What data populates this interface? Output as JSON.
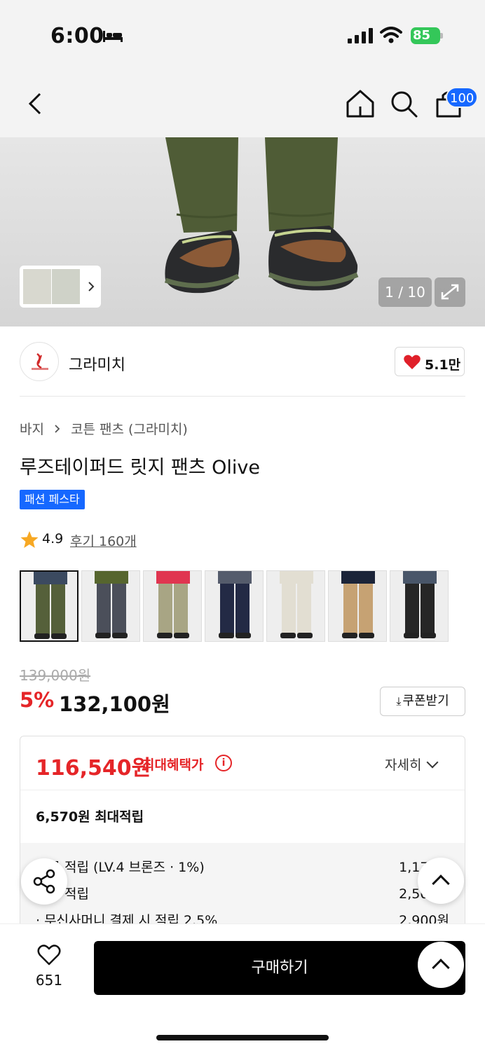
{
  "status": {
    "time": "6:00",
    "battery": "85"
  },
  "nav": {
    "cart_count": "100"
  },
  "hero": {
    "counter": "1 / 10"
  },
  "brand": {
    "name": "그라미치",
    "likes": "5.1만"
  },
  "product": {
    "breadcrumb": [
      "바지",
      "코튼 팬츠 (그라미치)"
    ],
    "title": "루즈테이퍼드 릿지 팬츠 Olive",
    "event_badge": "패션 페스타",
    "rating": "4.9",
    "reviews": "후기 160개",
    "swatches": [
      {
        "color": "olive",
        "pants": "#55603a",
        "top": "#3b4a60"
      },
      {
        "color": "charcoal",
        "pants": "#4b4f5a",
        "top": "#56652e"
      },
      {
        "color": "khaki",
        "pants": "#a8a584",
        "top": "#e03550"
      },
      {
        "color": "navy",
        "pants": "#232a45",
        "top": "#555c6c"
      },
      {
        "color": "ivory",
        "pants": "#e2ded2",
        "top": "#e2ded2"
      },
      {
        "color": "beige",
        "pants": "#c6a273",
        "top": "#1b2438"
      },
      {
        "color": "black",
        "pants": "#262626",
        "top": "#495669"
      }
    ]
  },
  "price": {
    "original": "139,000원",
    "discount": "5%",
    "sale": "132,100원",
    "coupon_label": "쿠폰받기"
  },
  "benefit": {
    "max_price": "116,540원",
    "max_label": "최대혜택가",
    "detail_label": "자세히",
    "max_points": "6,570원 최대적립",
    "rows": [
      {
        "label": "등급 적립 (LV.4 브론즈 · 1%)",
        "value": "1,170원"
      },
      {
        "label": "후기 적립",
        "value": "2,500원"
      },
      {
        "label": "· 무신사머니 결제 시 적립 2.5%",
        "value": "2,900원"
      }
    ]
  },
  "bottom": {
    "wish_count": "651",
    "buy_label": "구매하기"
  },
  "colors": {
    "accent_red": "#e52528",
    "accent_blue": "#1668ff"
  }
}
